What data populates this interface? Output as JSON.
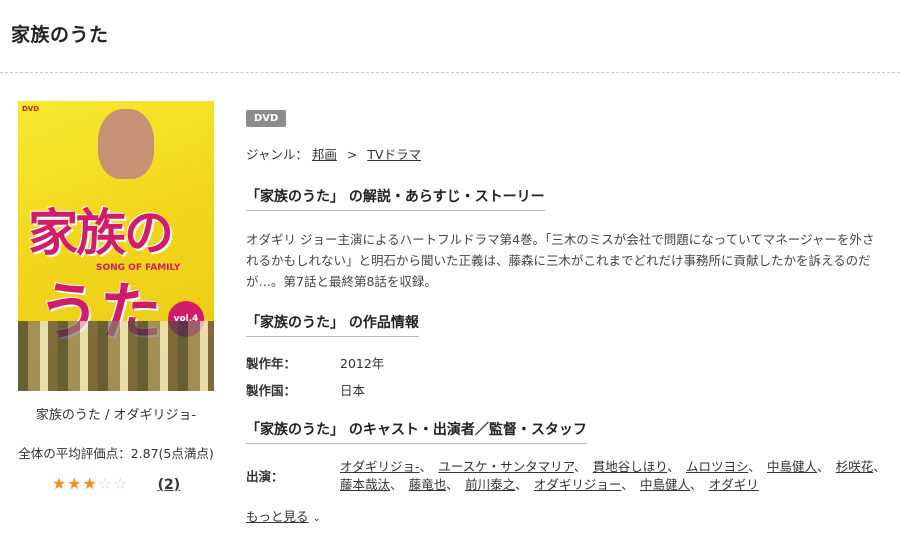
{
  "page": {
    "title": "家族のうた"
  },
  "poster": {
    "title_top": "家族の",
    "title_bottom": "うた",
    "subtitle": "SONG OF FAMILY",
    "vol": "vol.4",
    "logo": "DVD",
    "caption": "家族のうた / オダギリジョ-"
  },
  "rating": {
    "avg_text": "全体の平均評価点：2.87(5点満点)",
    "value": 2.87,
    "max": 5,
    "stars_filled": "★★★",
    "stars_empty": "☆☆",
    "count": "(2)"
  },
  "badge": "DVD",
  "genre": {
    "label": "ジャンル：",
    "items": [
      "邦画",
      "TVドラマ"
    ],
    "separator": ">"
  },
  "sections": {
    "synopsis_head": "「家族のうた」 の解説・あらすじ・ストーリー",
    "synopsis_text": "オダギリ ジョー主演によるハートフルドラマ第4巻。「三木のミスが会社で問題になっていてマネージャーを外されるかもしれない」と明石から聞いた正義は、藤森に三木がこれまでどれだけ事務所に貢献したかを訴えるのだが…。第7話と最終第8話を収録。",
    "info_head": "「家族のうた」 の作品情報",
    "cast_head": "「家族のうた」 のキャスト・出演者／監督・スタッフ"
  },
  "info": [
    {
      "label": "製作年：",
      "value": "2012年"
    },
    {
      "label": "製作国：",
      "value": "日本"
    }
  ],
  "cast": {
    "label": "出演：",
    "names": [
      "オダギリジョ-",
      "ユースケ・サンタマリア",
      "貫地谷しほり",
      "ムロツヨシ",
      "中島健人",
      "杉咲花",
      "藤本哉汰",
      "藤竜也",
      "前川泰之",
      "オダギリジョー",
      "中島健人",
      "オダギリ"
    ],
    "separator": "、"
  },
  "more": {
    "label": "もっと見る"
  }
}
